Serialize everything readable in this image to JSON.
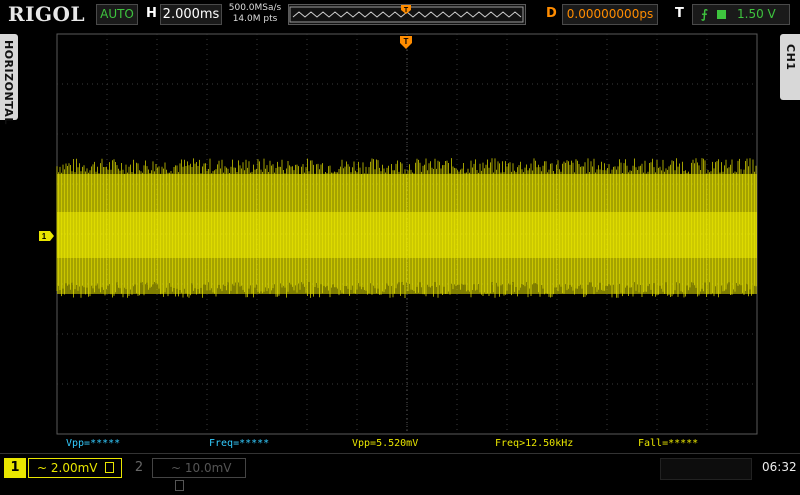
{
  "brand": {
    "logo": "RIGOL"
  },
  "top_bar": {
    "run_status": "AUTO",
    "horizontal_label": "H",
    "timebase": "2.000ms",
    "sample_rate": "500.0MSa/s",
    "memory_depth": "14.0M pts",
    "delay_label": "D",
    "delay": "0.00000000ps",
    "trigger_label": "T",
    "trigger_edge": "rising",
    "trigger_source": "CH1",
    "trigger_level": "1.50 V",
    "trigger_marker": "T"
  },
  "side_tabs": {
    "left": "HORIZONTAL",
    "right": "CH1"
  },
  "channel1": {
    "marker": "1",
    "color": "#e9e600"
  },
  "measurements": [
    {
      "text": "Vpp=*****",
      "color": "blue"
    },
    {
      "text": "Freq=*****",
      "color": "blue"
    },
    {
      "text": "Vpp=5.520mV",
      "color": "yellow"
    },
    {
      "text": "Freq>12.50kHz",
      "color": "yellow"
    },
    {
      "text": "Fall=*****",
      "color": "yellow"
    }
  ],
  "bottom_bar": {
    "ch1": {
      "number": "1",
      "coupling_icon": "~",
      "scale": "2.00mV"
    },
    "ch2": {
      "number": "2",
      "coupling_icon": "~",
      "scale": "10.0mV"
    },
    "clock": "06:32"
  },
  "colors": {
    "accent": "#ff8c00",
    "status_green": "#3ec43e",
    "ch1": "#e9e600",
    "meas_blue": "#33ccff"
  }
}
